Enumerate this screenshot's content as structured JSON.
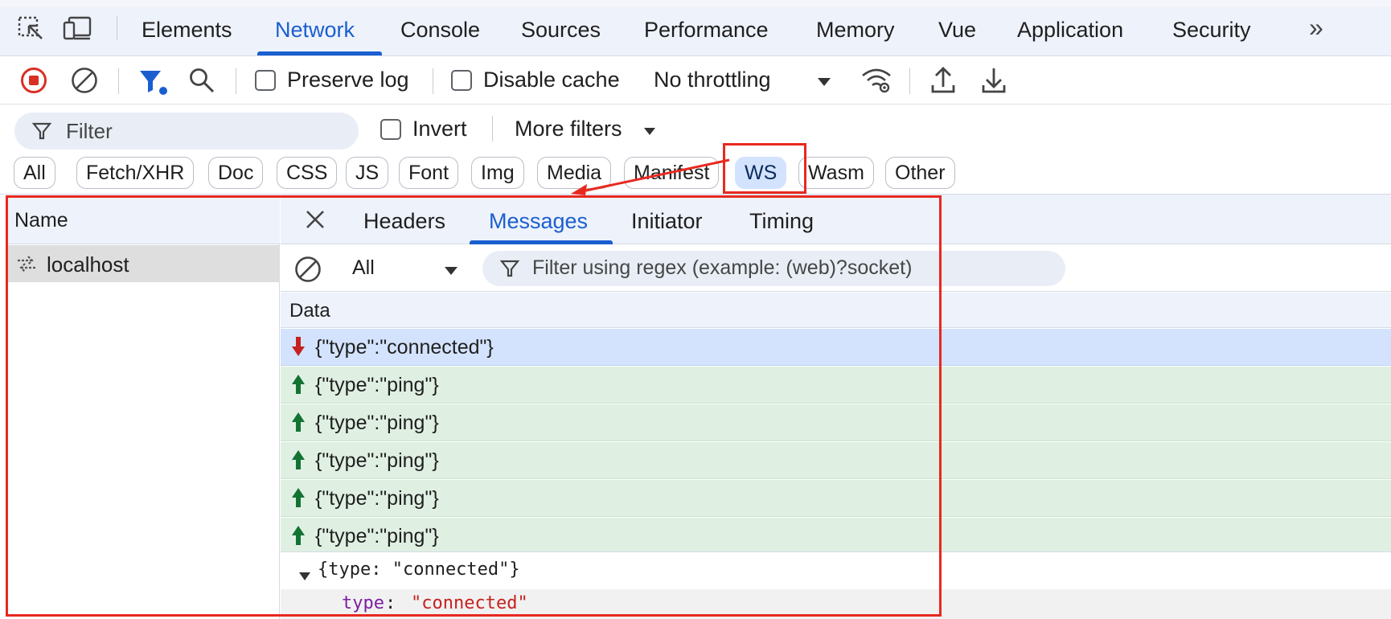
{
  "tabs": {
    "items": [
      "Elements",
      "Network",
      "Console",
      "Sources",
      "Performance",
      "Memory",
      "Vue",
      "Application",
      "Security"
    ],
    "active": "Network",
    "more": "»"
  },
  "toolbar": {
    "preserve_log": "Preserve log",
    "disable_cache": "Disable cache",
    "throttling": "No throttling"
  },
  "filter": {
    "placeholder": "Filter",
    "invert": "Invert",
    "more_filters": "More filters"
  },
  "type_chips": [
    "All",
    "Fetch/XHR",
    "Doc",
    "CSS",
    "JS",
    "Font",
    "Img",
    "Media",
    "Manifest",
    "WS",
    "Wasm",
    "Other"
  ],
  "type_chip_selected": "WS",
  "requests": {
    "header": "Name",
    "rows": [
      {
        "name": "localhost",
        "type": "websocket"
      }
    ]
  },
  "detail": {
    "tabs": [
      "Headers",
      "Messages",
      "Initiator",
      "Timing"
    ],
    "active_tab": "Messages",
    "message_filter": {
      "type_selected": "All",
      "regex_placeholder": "Filter using regex (example: (web)?socket)"
    },
    "data_header": "Data",
    "messages": [
      {
        "direction": "received",
        "data": "{\"type\":\"connected\"}"
      },
      {
        "direction": "sent",
        "data": "{\"type\":\"ping\"}"
      },
      {
        "direction": "sent",
        "data": "{\"type\":\"ping\"}"
      },
      {
        "direction": "sent",
        "data": "{\"type\":\"ping\"}"
      },
      {
        "direction": "sent",
        "data": "{\"type\":\"ping\"}"
      },
      {
        "direction": "sent",
        "data": "{\"type\":\"ping\"}"
      }
    ],
    "preview": {
      "summary": "{type: \"connected\"}",
      "prop_key": "type",
      "prop_sep": ": ",
      "prop_value": "\"connected\""
    }
  },
  "colors": {
    "accent": "#1a5fd0",
    "annotation": "#e8281f",
    "received_row": "#d3e3fd",
    "sent_row": "#dff0e2",
    "received_arrow": "#c5221f",
    "sent_arrow": "#137333"
  }
}
